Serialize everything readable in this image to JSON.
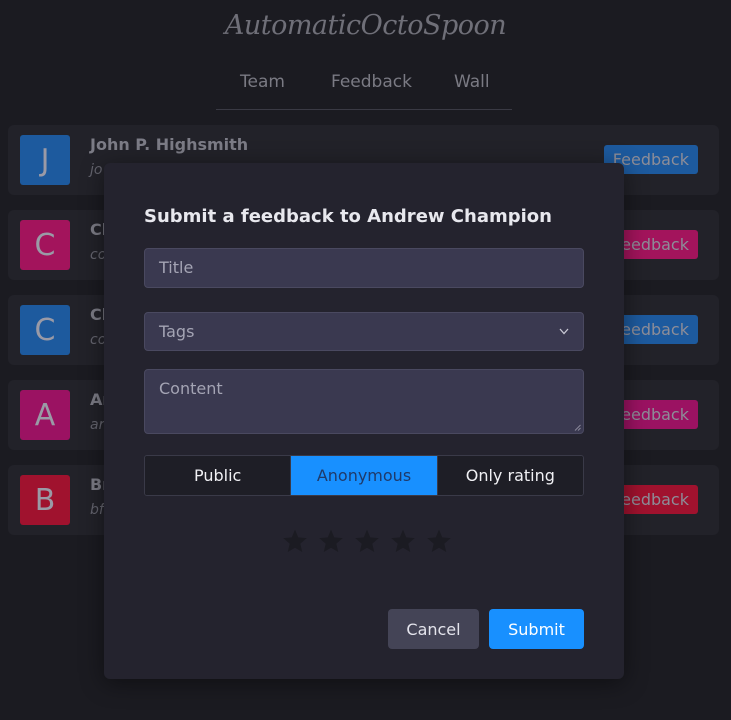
{
  "app": {
    "title": "AutomaticOctoSpoon"
  },
  "nav": {
    "items": [
      "Team",
      "Feedback",
      "Wall"
    ]
  },
  "members": [
    {
      "initial": "J",
      "name": "John P. Highsmith",
      "email": "jo",
      "color": "#1d5a9e",
      "button_color": "#1d5a9e",
      "button_label": "Feedback"
    },
    {
      "initial": "C",
      "name": "Cl",
      "email": "co",
      "color": "#a3145c",
      "button_color": "#a3145c",
      "button_label": "eedback"
    },
    {
      "initial": "C",
      "name": "Cl",
      "email": "co",
      "color": "#1d5a9e",
      "button_color": "#1d5a9e",
      "button_label": "eedback"
    },
    {
      "initial": "A",
      "name": "Ar",
      "email": "ar",
      "color": "#9b1262",
      "button_color": "#9b1262",
      "button_label": "eedback"
    },
    {
      "initial": "B",
      "name": "Br",
      "email": "bf",
      "color": "#a0122e",
      "button_color": "#a0122e",
      "button_label": "eedback"
    }
  ],
  "modal": {
    "title": "Submit a feedback to Andrew Champion",
    "title_placeholder": "Title",
    "tags_placeholder": "Tags",
    "content_placeholder": "Content",
    "visibility_options": [
      "Public",
      "Anonymous",
      "Only rating"
    ],
    "visibility_selected": "Anonymous",
    "rating": {
      "value": 0,
      "max": 5
    },
    "cancel_label": "Cancel",
    "submit_label": "Submit"
  },
  "colors": {
    "accent": "#1890ff",
    "star_empty": "#1b1b22"
  }
}
